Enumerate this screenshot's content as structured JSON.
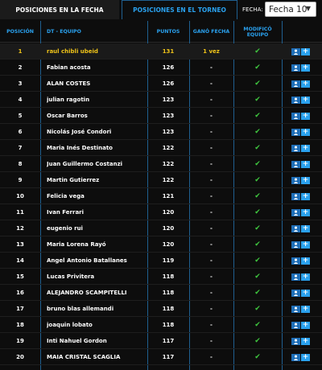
{
  "tabs": {
    "active_label": "POSICIONES EN LA FECHA",
    "inactive_label": "POSICIONES EN EL TORNEO"
  },
  "fecha": {
    "label": "FECHA:",
    "selected": "Fecha 10",
    "caret": "▼"
  },
  "columns": {
    "posicion": "POSICIÓN",
    "equipo": "DT - EQUIPO",
    "puntos": "PUNTOS",
    "gano": "GANÓ FECHA",
    "modifico_line1": "MODIFICÓ",
    "modifico_line2": "EQUIPO"
  },
  "icons": {
    "check": "✔",
    "add": "+"
  },
  "colors": {
    "accent": "#2aa1ee",
    "highlight": "#f0c419",
    "check": "#3fc63f"
  },
  "rows": [
    {
      "pos": "1",
      "name": "raul chibli ubeid",
      "pts": "131",
      "gano": "1 vez"
    },
    {
      "pos": "2",
      "name": "Fabian acosta",
      "pts": "126",
      "gano": "-"
    },
    {
      "pos": "3",
      "name": "ALAN COSTES",
      "pts": "126",
      "gano": "-"
    },
    {
      "pos": "4",
      "name": "julian ragotin",
      "pts": "123",
      "gano": "-"
    },
    {
      "pos": "5",
      "name": "Oscar Barros",
      "pts": "123",
      "gano": "-"
    },
    {
      "pos": "6",
      "name": "Nicolás José Condori",
      "pts": "123",
      "gano": "-"
    },
    {
      "pos": "7",
      "name": "Maria Inés Destinato",
      "pts": "122",
      "gano": "-"
    },
    {
      "pos": "8",
      "name": "Juan Guillermo Costanzi",
      "pts": "122",
      "gano": "-"
    },
    {
      "pos": "9",
      "name": "Martin Gutierrez",
      "pts": "122",
      "gano": "-"
    },
    {
      "pos": "10",
      "name": "Felicia vega",
      "pts": "121",
      "gano": "-"
    },
    {
      "pos": "11",
      "name": "Ivan Ferrari",
      "pts": "120",
      "gano": "-"
    },
    {
      "pos": "12",
      "name": "eugenio rui",
      "pts": "120",
      "gano": "-"
    },
    {
      "pos": "13",
      "name": "Maria Lorena Rayó",
      "pts": "120",
      "gano": "-"
    },
    {
      "pos": "14",
      "name": "Angel Antonio Batallanes",
      "pts": "119",
      "gano": "-"
    },
    {
      "pos": "15",
      "name": "Lucas Privitera",
      "pts": "118",
      "gano": "-"
    },
    {
      "pos": "16",
      "name": "ALEJANDRO SCAMPITELLI",
      "pts": "118",
      "gano": "-"
    },
    {
      "pos": "17",
      "name": "bruno blas allemandi",
      "pts": "118",
      "gano": "-"
    },
    {
      "pos": "18",
      "name": "joaquin lobato",
      "pts": "118",
      "gano": "-"
    },
    {
      "pos": "19",
      "name": "Inti Nahuel Gordon",
      "pts": "117",
      "gano": "-"
    },
    {
      "pos": "20",
      "name": "MAIA CRISTAL SCAGLIA",
      "pts": "117",
      "gano": "-"
    }
  ]
}
